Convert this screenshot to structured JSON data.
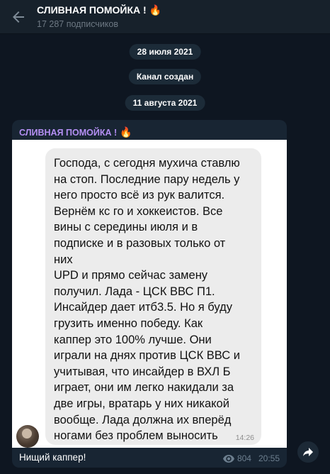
{
  "header": {
    "title": "СЛИВНАЯ ПОМОЙКА !",
    "title_emoji": "🔥",
    "subscribers": "17 287 подписчиков"
  },
  "service": [
    {
      "text": "28 июля 2021"
    },
    {
      "text": "Канал создан"
    },
    {
      "text": "11 августа 2021"
    }
  ],
  "message": {
    "author": "СЛИВНАЯ ПОМОЙКА !",
    "author_emoji": "🔥",
    "image_text": "Господа, с сегодня мухича ставлю\nна стоп. Последние пару недель у\nнего просто всё из рук валится.\nВернём кс го и хоккеистов. Все\nвины с середины июля и в\nподписке и в разовых только от\nних\nUPD и прямо сейчас замену\nполучил. Лада - ЦСК ВВС П1.\nИнсайдер дает итб3.5. Но я буду\nгрузить именно победу. Как\nкаппер это 100% лучше. Они\nиграли на днях против ЦСК ВВС и\nучитывая, что инсайдер в ВХЛ Б\nиграет, они им легко накидали за\nдве игры, вратарь у них никакой\nвообще. Лада должна их вперёд\nногами без проблем выносить",
    "image_time": "14:26",
    "caption": "Нищий каппер!",
    "views": "804",
    "time": "20:55"
  },
  "colors": {
    "background": "#0e1621",
    "header": "#17212b",
    "bubble": "#182533",
    "author": "#b48ff3",
    "meta": "#6d7f8f"
  },
  "icons": {
    "back": "arrow-left-icon",
    "views": "eye-icon",
    "share": "share-arrow-icon"
  }
}
